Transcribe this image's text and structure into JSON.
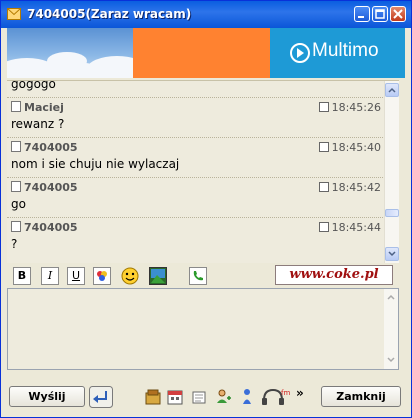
{
  "window": {
    "title": "7404005(Zaraz wracam)"
  },
  "banner": {
    "brand": "Multimo"
  },
  "chat": {
    "partial_top_text": "gogogo",
    "messages": [
      {
        "sender": "Maciej",
        "time": "18:45:26",
        "text": "rewanz ?"
      },
      {
        "sender": "7404005",
        "time": "18:45:40",
        "text": "nom i sie chuju nie wylaczaj"
      },
      {
        "sender": "7404005",
        "time": "18:45:42",
        "text": "go"
      },
      {
        "sender": "7404005",
        "time": "18:45:44",
        "text": "?"
      }
    ]
  },
  "format_toolbar": {
    "bold": "B",
    "italic": "I",
    "underline": "U",
    "ad_logo": "www.coke.pl"
  },
  "input": {
    "value": ""
  },
  "buttons": {
    "send": "Wyślij",
    "close": "Zamknij",
    "more": "»"
  },
  "colors": {
    "titlebar": "#0a5ee0",
    "chat_bg": "#eeebdd",
    "banner_orange": "#ff8230",
    "banner_blue": "#1e9ad6"
  },
  "icons": [
    "mail-icon",
    "minimize-icon",
    "maximize-icon",
    "close-icon",
    "color-icon",
    "smiley-icon",
    "image-icon",
    "phone-icon",
    "enter-icon",
    "file-transfer-icon",
    "calendar-icon",
    "note-icon",
    "add-contact-icon",
    "contact-info-icon",
    "radio-icon"
  ]
}
